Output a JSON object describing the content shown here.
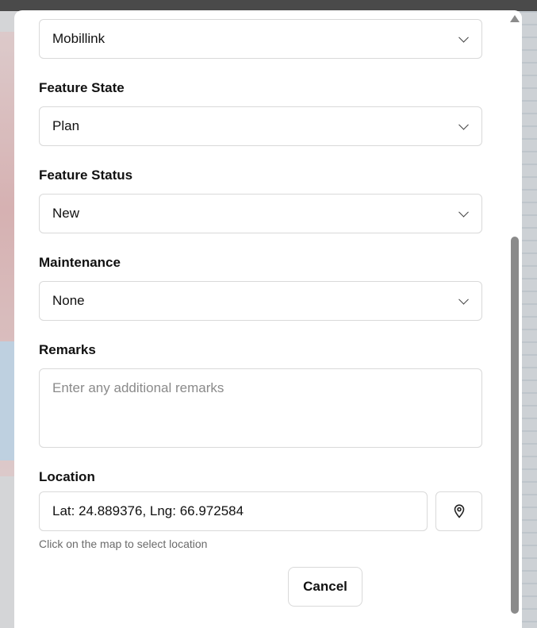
{
  "form": {
    "provider": {
      "value": "Mobillink"
    },
    "feature_state": {
      "label": "Feature State",
      "value": "Plan"
    },
    "feature_status": {
      "label": "Feature Status",
      "value": "New"
    },
    "maintenance": {
      "label": "Maintenance",
      "value": "None"
    },
    "remarks": {
      "label": "Remarks",
      "placeholder": "Enter any additional remarks",
      "value": ""
    },
    "location": {
      "label": "Location",
      "value": "Lat: 24.889376, Lng: 66.972584",
      "hint": "Click on the map to select location",
      "pin_icon": "map-pin-icon"
    }
  },
  "actions": {
    "cancel_label": "Cancel"
  },
  "icons": {
    "dropdown": "chevron-down-icon",
    "scroll_up": "triangle-up-icon",
    "scroll_down": "triangle-down-icon"
  },
  "colors": {
    "border": "#d9d9d9",
    "text": "#111111",
    "hint": "#6b6b6b",
    "scroll_thumb": "#8b8b8b"
  }
}
